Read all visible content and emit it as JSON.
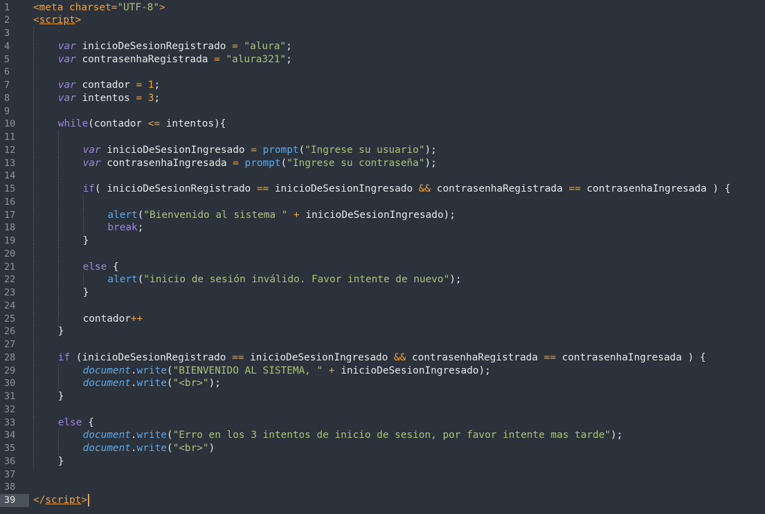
{
  "editor": {
    "active_line": 39,
    "colors": {
      "background": "#2b323b",
      "keyword": "#9f86d9",
      "string": "#a8c37c",
      "operator": "#f0a23c",
      "function": "#5fa8e8",
      "text": "#e8e8e8",
      "line_number": "#8c949c"
    },
    "lines": [
      {
        "n": "1",
        "indent": 0,
        "tokens": [
          [
            "tag",
            "<"
          ],
          [
            "tag",
            "meta"
          ],
          [
            "text",
            " "
          ],
          [
            "attr",
            "charset"
          ],
          [
            "op",
            "="
          ],
          [
            "str",
            "\"UTF-8\""
          ],
          [
            "tag",
            ">"
          ]
        ]
      },
      {
        "n": "2",
        "indent": 0,
        "tokens": [
          [
            "tag",
            "<"
          ],
          [
            "tagname",
            "script"
          ],
          [
            "tag",
            ">"
          ]
        ]
      },
      {
        "n": "3",
        "indent": 1,
        "tokens": []
      },
      {
        "n": "4",
        "indent": 1,
        "tokens": [
          [
            "kw",
            "var"
          ],
          [
            "text",
            " inicioDeSesionRegistrado "
          ],
          [
            "op",
            "="
          ],
          [
            "text",
            " "
          ],
          [
            "str",
            "\"alura\""
          ],
          [
            "text",
            ";"
          ]
        ]
      },
      {
        "n": "5",
        "indent": 1,
        "tokens": [
          [
            "kw",
            "var"
          ],
          [
            "text",
            " contrasenhaRegistrada "
          ],
          [
            "op",
            "="
          ],
          [
            "text",
            " "
          ],
          [
            "str",
            "\"alura321\""
          ],
          [
            "text",
            ";"
          ]
        ]
      },
      {
        "n": "6",
        "indent": 1,
        "tokens": []
      },
      {
        "n": "7",
        "indent": 1,
        "tokens": [
          [
            "kw",
            "var"
          ],
          [
            "text",
            " contador "
          ],
          [
            "op",
            "="
          ],
          [
            "text",
            " "
          ],
          [
            "num",
            "1"
          ],
          [
            "text",
            ";"
          ]
        ]
      },
      {
        "n": "8",
        "indent": 1,
        "tokens": [
          [
            "kw",
            "var"
          ],
          [
            "text",
            " intentos "
          ],
          [
            "op",
            "="
          ],
          [
            "text",
            " "
          ],
          [
            "num",
            "3"
          ],
          [
            "text",
            ";"
          ]
        ]
      },
      {
        "n": "9",
        "indent": 1,
        "tokens": []
      },
      {
        "n": "10",
        "indent": 1,
        "tokens": [
          [
            "ctrl",
            "while"
          ],
          [
            "text",
            "(contador "
          ],
          [
            "op",
            "<="
          ],
          [
            "text",
            " intentos){"
          ]
        ]
      },
      {
        "n": "11",
        "indent": 2,
        "tokens": []
      },
      {
        "n": "12",
        "indent": 2,
        "tokens": [
          [
            "kw",
            "var"
          ],
          [
            "text",
            " inicioDeSesionIngresado "
          ],
          [
            "op",
            "="
          ],
          [
            "text",
            " "
          ],
          [
            "func",
            "prompt"
          ],
          [
            "text",
            "("
          ],
          [
            "str",
            "\"Ingrese su usuario\""
          ],
          [
            "text",
            ");"
          ]
        ]
      },
      {
        "n": "13",
        "indent": 2,
        "tokens": [
          [
            "kw",
            "var"
          ],
          [
            "text",
            " contrasenhaIngresada "
          ],
          [
            "op",
            "="
          ],
          [
            "text",
            " "
          ],
          [
            "func",
            "prompt"
          ],
          [
            "text",
            "("
          ],
          [
            "str",
            "\"Ingrese su contraseña\""
          ],
          [
            "text",
            ");"
          ]
        ]
      },
      {
        "n": "14",
        "indent": 2,
        "tokens": []
      },
      {
        "n": "15",
        "indent": 2,
        "tokens": [
          [
            "ctrl",
            "if"
          ],
          [
            "text",
            "( inicioDeSesionRegistrado "
          ],
          [
            "op",
            "=="
          ],
          [
            "text",
            " inicioDeSesionIngresado "
          ],
          [
            "op",
            "&&"
          ],
          [
            "text",
            " contrasenhaRegistrada "
          ],
          [
            "op",
            "=="
          ],
          [
            "text",
            " contrasenhaIngresada ) {"
          ]
        ]
      },
      {
        "n": "16",
        "indent": 3,
        "tokens": []
      },
      {
        "n": "17",
        "indent": 3,
        "tokens": [
          [
            "func",
            "alert"
          ],
          [
            "text",
            "("
          ],
          [
            "str",
            "\"Bienvenido al sistema \""
          ],
          [
            "text",
            " "
          ],
          [
            "op",
            "+"
          ],
          [
            "text",
            " inicioDeSesionIngresado);"
          ]
        ]
      },
      {
        "n": "18",
        "indent": 3,
        "tokens": [
          [
            "ctrl",
            "break"
          ],
          [
            "text",
            ";"
          ]
        ]
      },
      {
        "n": "19",
        "indent": 2,
        "tokens": [
          [
            "text",
            "}"
          ]
        ]
      },
      {
        "n": "20",
        "indent": 2,
        "tokens": []
      },
      {
        "n": "21",
        "indent": 2,
        "tokens": [
          [
            "ctrl",
            "else"
          ],
          [
            "text",
            " {"
          ]
        ]
      },
      {
        "n": "22",
        "indent": 3,
        "tokens": [
          [
            "func",
            "alert"
          ],
          [
            "text",
            "("
          ],
          [
            "str",
            "\"inicio de sesión inválido. Favor intente de nuevo\""
          ],
          [
            "text",
            ");"
          ]
        ]
      },
      {
        "n": "23",
        "indent": 2,
        "tokens": [
          [
            "text",
            "}"
          ]
        ]
      },
      {
        "n": "24",
        "indent": 2,
        "tokens": []
      },
      {
        "n": "25",
        "indent": 2,
        "tokens": [
          [
            "text",
            "contador"
          ],
          [
            "op",
            "++"
          ]
        ]
      },
      {
        "n": "26",
        "indent": 1,
        "tokens": [
          [
            "text",
            "}"
          ]
        ]
      },
      {
        "n": "27",
        "indent": 1,
        "tokens": []
      },
      {
        "n": "28",
        "indent": 1,
        "tokens": [
          [
            "ctrl",
            "if"
          ],
          [
            "text",
            " (inicioDeSesionRegistrado "
          ],
          [
            "op",
            "=="
          ],
          [
            "text",
            " inicioDeSesionIngresado "
          ],
          [
            "op",
            "&&"
          ],
          [
            "text",
            " contrasenhaRegistrada "
          ],
          [
            "op",
            "=="
          ],
          [
            "text",
            " contrasenhaIngresada ) {"
          ]
        ]
      },
      {
        "n": "29",
        "indent": 2,
        "tokens": [
          [
            "obj",
            "document"
          ],
          [
            "text",
            "."
          ],
          [
            "meth",
            "write"
          ],
          [
            "text",
            "("
          ],
          [
            "str",
            "\"BIENVENIDO AL SISTEMA, \""
          ],
          [
            "text",
            " "
          ],
          [
            "op",
            "+"
          ],
          [
            "text",
            " inicioDeSesionIngresado);"
          ]
        ]
      },
      {
        "n": "30",
        "indent": 2,
        "tokens": [
          [
            "obj",
            "document"
          ],
          [
            "text",
            "."
          ],
          [
            "meth",
            "write"
          ],
          [
            "text",
            "("
          ],
          [
            "str",
            "\"<br>\""
          ],
          [
            "text",
            ");"
          ]
        ]
      },
      {
        "n": "31",
        "indent": 1,
        "tokens": [
          [
            "text",
            "}"
          ]
        ]
      },
      {
        "n": "32",
        "indent": 1,
        "tokens": []
      },
      {
        "n": "33",
        "indent": 1,
        "tokens": [
          [
            "ctrl",
            "else"
          ],
          [
            "text",
            " {"
          ]
        ]
      },
      {
        "n": "34",
        "indent": 2,
        "tokens": [
          [
            "obj",
            "document"
          ],
          [
            "text",
            "."
          ],
          [
            "meth",
            "write"
          ],
          [
            "text",
            "("
          ],
          [
            "str",
            "\"Erro en los 3 intentos de inicio de sesion, por favor intente mas tarde\""
          ],
          [
            "text",
            ");"
          ]
        ]
      },
      {
        "n": "35",
        "indent": 2,
        "tokens": [
          [
            "obj",
            "document"
          ],
          [
            "text",
            "."
          ],
          [
            "meth",
            "write"
          ],
          [
            "text",
            "("
          ],
          [
            "str",
            "\"<br>\""
          ],
          [
            "text",
            ")"
          ]
        ]
      },
      {
        "n": "36",
        "indent": 1,
        "tokens": [
          [
            "text",
            "}"
          ]
        ]
      },
      {
        "n": "37",
        "indent": 0,
        "tokens": []
      },
      {
        "n": "38",
        "indent": 0,
        "tokens": []
      },
      {
        "n": "39",
        "indent": 0,
        "tokens": [
          [
            "tag",
            "</"
          ],
          [
            "tagname",
            "script"
          ],
          [
            "tag",
            ">"
          ]
        ]
      }
    ]
  }
}
